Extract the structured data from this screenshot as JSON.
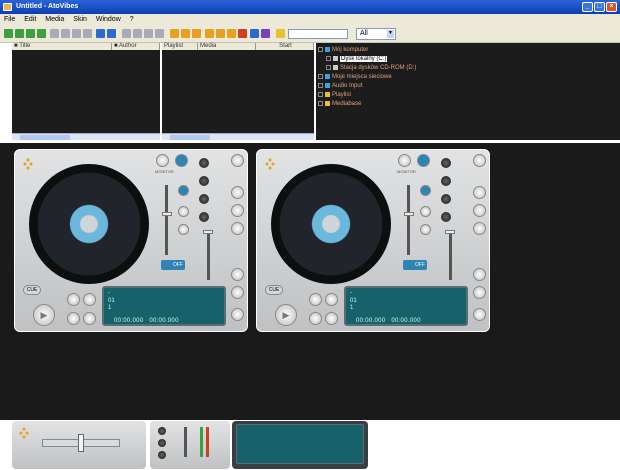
{
  "window": {
    "title": "Untitled - AtoVibes",
    "min": "_",
    "max": "□",
    "close": "×"
  },
  "menu": [
    "File",
    "Edit",
    "Media",
    "Skin",
    "Window",
    "?"
  ],
  "toolbar": {
    "filter_value": "",
    "filter_scope": "All"
  },
  "browser": {
    "columns_left": [
      "Title",
      "Author"
    ],
    "columns_right": [
      "Playlist",
      "Media",
      "Start"
    ]
  },
  "tree": [
    {
      "label": "Mój komputer",
      "level": 0,
      "icon": "computer-icon",
      "selected": false
    },
    {
      "label": "Dysk lokalny (C:)",
      "level": 1,
      "icon": "drive-icon",
      "selected": true
    },
    {
      "label": "Stacja dysków CD-ROM (D:)",
      "level": 1,
      "icon": "cdrom-icon",
      "selected": false
    },
    {
      "label": "Moje miejsca sieciowe",
      "level": 0,
      "icon": "network-icon",
      "selected": false
    },
    {
      "label": "Audio Input",
      "level": 0,
      "icon": "audio-input-icon",
      "selected": false
    },
    {
      "label": "Playlist",
      "level": 0,
      "icon": "folder-icon",
      "selected": false
    },
    {
      "label": "Mediabase",
      "level": 0,
      "icon": "folder-icon",
      "selected": false
    }
  ],
  "decks": [
    {
      "lcd_title": "-",
      "lcd_number": "01",
      "lcd_artist": "1",
      "time_elapsed": "00:00.000",
      "time_remaining": "00:00.000",
      "bpm": "OFF",
      "cue_label": "CUE",
      "play_symbol": "▶"
    },
    {
      "lcd_title": "-",
      "lcd_number": "01",
      "lcd_artist": "1",
      "time_elapsed": "00:00.000",
      "time_remaining": "00:00.000",
      "bpm": "OFF",
      "cue_label": "CUE",
      "play_symbol": "▶"
    }
  ],
  "colors": {
    "accent": "#2a63d8",
    "lcd": "#16616a",
    "tree_text": "#e0a080"
  }
}
